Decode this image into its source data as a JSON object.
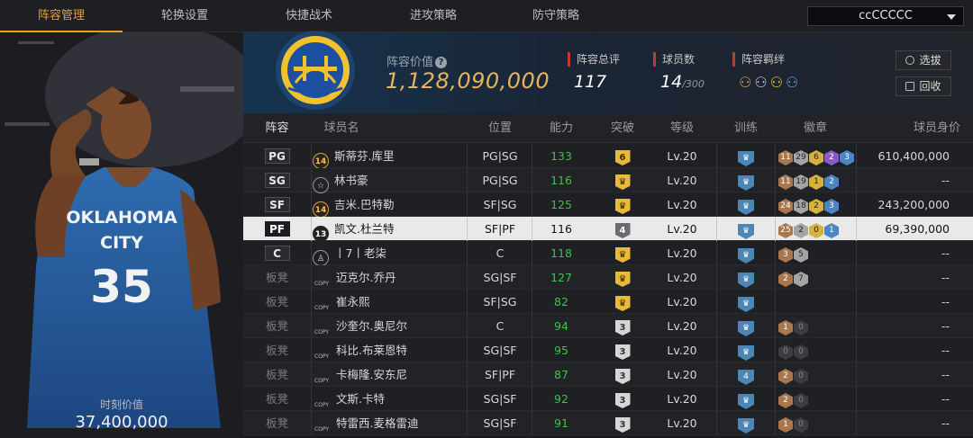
{
  "tabs": [
    "阵容管理",
    "轮换设置",
    "快捷战术",
    "进攻策略",
    "防守策略"
  ],
  "team_select": {
    "value": "ccCCCCC"
  },
  "player_panel": {
    "jersey_text": "OKLAHOMA CITY",
    "jersey_number": "35",
    "moment_label": "时刻价值",
    "moment_value": "37,400,000"
  },
  "header": {
    "lineup_value_label": "阵容价值",
    "lineup_value": "1,128,090,000",
    "overall_label": "阵容总评",
    "overall_value": "117",
    "count_label": "球员数",
    "count_value": "14",
    "count_max": "/300",
    "bond_label": "阵容羁绊",
    "select_btn": "选拔",
    "recycle_btn": "回收"
  },
  "columns": [
    "阵容",
    "球员名",
    "位置",
    "能力",
    "突破",
    "等级",
    "训练",
    "徽章",
    "球员身价"
  ],
  "colors": {
    "accent": "#e6a12a",
    "ability_green": "#3fbf4f",
    "value_gold": "#e8b35a"
  },
  "rows": [
    {
      "slot": "PG",
      "icon": "num",
      "icon_text": "14",
      "name": "斯蒂芬.库里",
      "pos": "PG|SG",
      "ability": "133",
      "brk": "6",
      "brk_type": "gold",
      "level": "Lv.20",
      "train": "",
      "badges": [
        [
          "br",
          "11"
        ],
        [
          "sv",
          "29"
        ],
        [
          "gd",
          "6"
        ],
        [
          "pu",
          "2"
        ],
        [
          "bl",
          "3"
        ]
      ],
      "value": "610,400,000"
    },
    {
      "slot": "SG",
      "icon": "star",
      "icon_text": "☆",
      "name": "林书豪",
      "pos": "PG|SG",
      "ability": "116",
      "brk": "",
      "brk_type": "gold",
      "level": "Lv.20",
      "train": "",
      "badges": [
        [
          "br",
          "11"
        ],
        [
          "sv",
          "19"
        ],
        [
          "gd",
          "1"
        ],
        [
          "bl",
          "2"
        ]
      ],
      "value": "--"
    },
    {
      "slot": "SF",
      "icon": "num",
      "icon_text": "14",
      "name": "吉米.巴特勒",
      "pos": "SF|SG",
      "ability": "125",
      "brk": "",
      "brk_type": "gold",
      "level": "Lv.20",
      "train": "",
      "badges": [
        [
          "br",
          "24"
        ],
        [
          "sv",
          "18"
        ],
        [
          "gd",
          "2"
        ],
        [
          "bl",
          "3"
        ]
      ],
      "value": "243,200,000"
    },
    {
      "slot": "PF",
      "icon": "num",
      "icon_text": "13",
      "name": "凯文.杜兰特",
      "pos": "SF|PF",
      "ability": "116",
      "brk": "4",
      "brk_type": "dark",
      "level": "Lv.20",
      "train": "",
      "badges": [
        [
          "br",
          "25"
        ],
        [
          "sv",
          "2"
        ],
        [
          "gd",
          "0"
        ],
        [
          "bl",
          "1"
        ]
      ],
      "value": "69,390,000",
      "selected": true
    },
    {
      "slot": "C",
      "icon": "person",
      "icon_text": "♙",
      "name": "丨7丨老柒",
      "pos": "C",
      "ability": "118",
      "brk": "",
      "brk_type": "gold",
      "level": "Lv.20",
      "train": "",
      "badges": [
        [
          "br",
          "3"
        ],
        [
          "sv",
          "5"
        ]
      ],
      "value": "--"
    },
    {
      "slot": "板凳",
      "icon": "copy",
      "icon_text": "COPY",
      "name": "迈克尔.乔丹",
      "pos": "SG|SF",
      "ability": "127",
      "brk": "",
      "brk_type": "gold",
      "level": "Lv.20",
      "train": "",
      "badges": [
        [
          "br",
          "2"
        ],
        [
          "sv",
          "7"
        ]
      ],
      "value": "--"
    },
    {
      "slot": "板凳",
      "icon": "copy",
      "icon_text": "COPY",
      "name": "崔永熙",
      "pos": "SF|SG",
      "ability": "82",
      "brk": "",
      "brk_type": "gold",
      "level": "Lv.20",
      "train": "",
      "badges": [],
      "value": "--"
    },
    {
      "slot": "板凳",
      "icon": "copy",
      "icon_text": "COPY",
      "name": "沙奎尔.奥尼尔",
      "pos": "C",
      "ability": "94",
      "brk": "3",
      "brk_type": "grey",
      "level": "Lv.20",
      "train": "",
      "badges": [
        [
          "br",
          "1"
        ],
        [
          "dk",
          "0"
        ]
      ],
      "value": "--"
    },
    {
      "slot": "板凳",
      "icon": "copy",
      "icon_text": "COPY",
      "name": "科比.布莱恩特",
      "pos": "SG|SF",
      "ability": "95",
      "brk": "3",
      "brk_type": "grey",
      "level": "Lv.20",
      "train": "",
      "badges": [
        [
          "dk",
          "0"
        ],
        [
          "dk",
          "0"
        ]
      ],
      "value": "--"
    },
    {
      "slot": "板凳",
      "icon": "copy",
      "icon_text": "COPY",
      "name": "卡梅隆.安东尼",
      "pos": "SF|PF",
      "ability": "87",
      "brk": "3",
      "brk_type": "grey",
      "level": "Lv.20",
      "train": "4",
      "badges": [
        [
          "br",
          "2"
        ],
        [
          "dk",
          "0"
        ]
      ],
      "value": "--"
    },
    {
      "slot": "板凳",
      "icon": "copy",
      "icon_text": "COPY",
      "name": "文斯.卡特",
      "pos": "SG|SF",
      "ability": "92",
      "brk": "3",
      "brk_type": "grey",
      "level": "Lv.20",
      "train": "",
      "badges": [
        [
          "br",
          "2"
        ],
        [
          "dk",
          "0"
        ]
      ],
      "value": "--"
    },
    {
      "slot": "板凳",
      "icon": "copy",
      "icon_text": "COPY",
      "name": "特雷西.麦格雷迪",
      "pos": "SG|SF",
      "ability": "91",
      "brk": "3",
      "brk_type": "grey",
      "level": "Lv.20",
      "train": "",
      "badges": [
        [
          "br",
          "1"
        ],
        [
          "dk",
          "0"
        ]
      ],
      "value": "--"
    }
  ]
}
